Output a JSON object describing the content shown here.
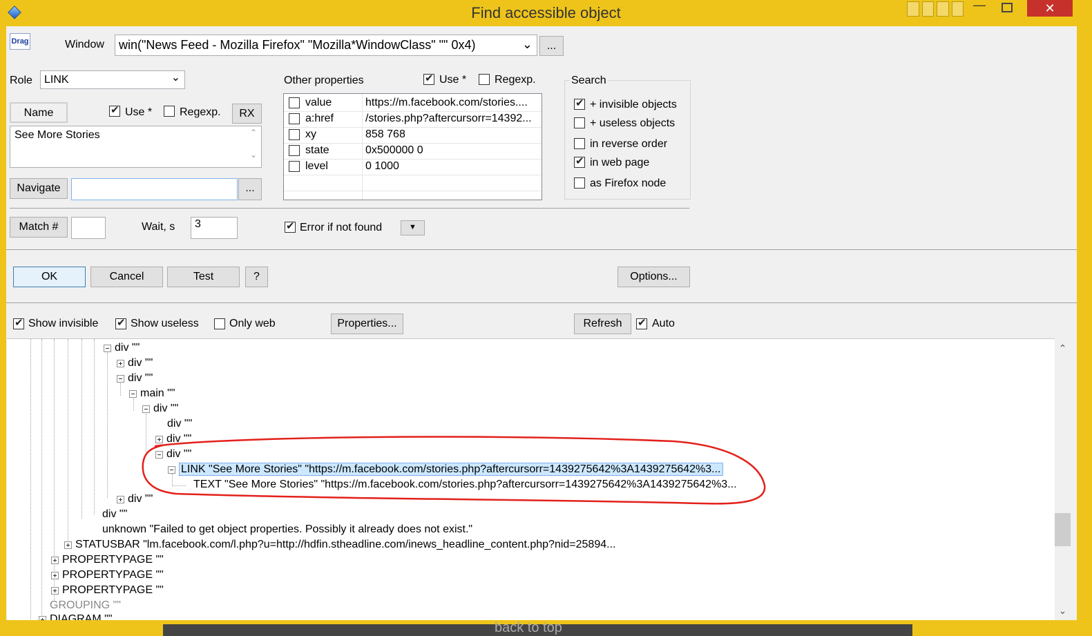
{
  "window": {
    "title": "Find accessible object",
    "accent_color": "#eec41b"
  },
  "top": {
    "drag_label": "Drag",
    "window_label": "Window",
    "window_value": "win(\"News Feed - Mozilla Firefox\" \"Mozilla*WindowClass\" \"\" 0x4)",
    "browse_label": "...",
    "role_label": "Role",
    "role_value": "LINK",
    "name_label": "Name",
    "name_use_label": "Use *",
    "name_regexp_label": "Regexp.",
    "rx_label": "RX",
    "name_value": "See More Stories",
    "navigate_label": "Navigate",
    "navigate_value": "",
    "navigate_browse": "...",
    "match_label": "Match #",
    "match_value": "",
    "wait_label": "Wait, s",
    "wait_value": "3",
    "error_label": "Error if not found"
  },
  "other_properties": {
    "title": "Other properties",
    "use_label": "Use *",
    "regexp_label": "Regexp.",
    "rows": [
      {
        "name": "value",
        "value": "https://m.facebook.com/stories...."
      },
      {
        "name": "a:href",
        "value": "/stories.php?aftercursorr=14392..."
      },
      {
        "name": "xy",
        "value": "858 768"
      },
      {
        "name": "state",
        "value": "0x500000 0"
      },
      {
        "name": "level",
        "value": "0 1000"
      }
    ]
  },
  "search": {
    "title": "Search",
    "options": [
      {
        "label": "+ invisible objects",
        "checked": true
      },
      {
        "label": "+ useless objects",
        "checked": false
      },
      {
        "label": "in reverse order",
        "checked": false
      },
      {
        "label": "in web page",
        "checked": true
      },
      {
        "label": "as Firefox node",
        "checked": false
      }
    ]
  },
  "actions": {
    "ok": "OK",
    "cancel": "Cancel",
    "test": "Test",
    "help": "?",
    "options": "Options..."
  },
  "tree_toolbar": {
    "show_invisible": "Show invisible",
    "show_useless": "Show useless",
    "only_web": "Only web",
    "properties": "Properties...",
    "refresh": "Refresh",
    "auto": "Auto"
  },
  "tree": [
    "div  \"\"",
    "div  \"\"",
    "div  \"\"",
    "main  \"\"",
    "div  \"\"",
    "div  \"\"",
    "div  \"\"",
    "div  \"\"",
    "LINK  \"See More Stories\"  \"https://m.facebook.com/stories.php?aftercursorr=1439275642%3A1439275642%3...",
    "TEXT  \"See More Stories\"  \"https://m.facebook.com/stories.php?aftercursorr=1439275642%3A1439275642%3...",
    "div  \"\"",
    "div  \"\"",
    "unknown  \"Failed to get object properties. Possibly it already does not exist.\"",
    "STATUSBAR  \"lm.facebook.com/l.php?u=http://hdfin.stheadline.com/inews_headline_content.php?nid=25894...",
    "PROPERTYPAGE  \"\"",
    "PROPERTYPAGE  \"\"",
    "PROPERTYPAGE  \"\"",
    "GROUPING  \"\"",
    "DIAGRAM  \"\""
  ],
  "bottom": {
    "text": "back to top"
  }
}
